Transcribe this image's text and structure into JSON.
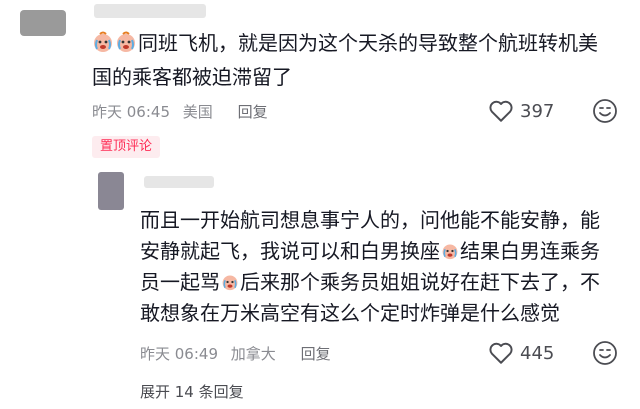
{
  "comment": {
    "text_lines": [
      "同班飞机，就是因为这个天杀的导致整个航班转机美",
      "国的乘客都被迫滞留了"
    ],
    "emoji_name": "crying-face-emoji",
    "time": "昨天 06:45",
    "location": "美国",
    "reply_label": "回复",
    "likes": "397",
    "pinned_label": "置顶评论"
  },
  "reply": {
    "line1": "而且一开始航司想息事宁人的，问他能不能安静，能",
    "line2a": "安静就起飞，我说可以和白男换座",
    "line2b": "结果白男连乘务",
    "line3a": "员一起骂",
    "line3b": "后来那个乘务员姐姐说好在赶下去了，不",
    "line4": "敢想象在万米高空有这么个定时炸弹是什么感觉",
    "emoji_name": "crying-face-emoji",
    "time": "昨天 06:49",
    "location": "加拿大",
    "reply_label": "回复",
    "likes": "445"
  },
  "expand_label": "展开 14 条回复",
  "colors": {
    "accent": "#fe2c55",
    "meta": "#8a8b91",
    "text": "#161823"
  }
}
